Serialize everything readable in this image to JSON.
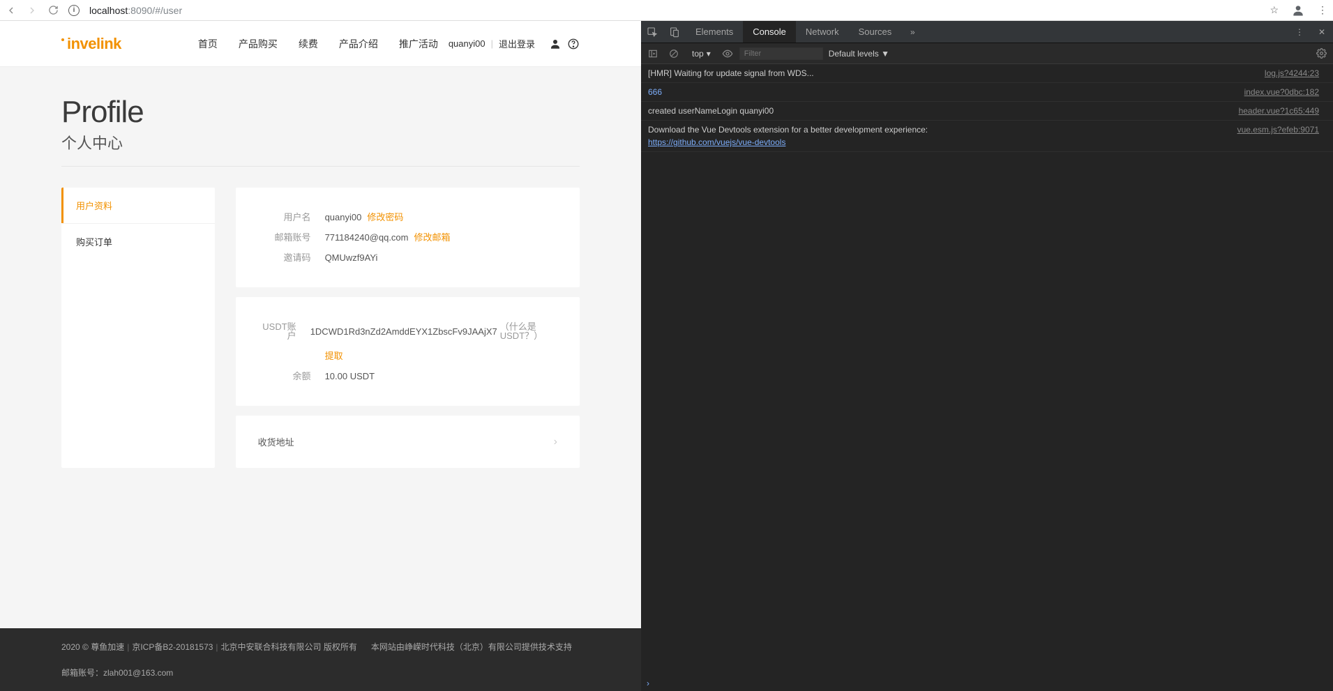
{
  "browser": {
    "url_host": "localhost",
    "url_port_path": ":8090/#/user"
  },
  "header": {
    "logo": "invelink",
    "nav": [
      "首页",
      "产品购买",
      "续费",
      "产品介绍",
      "推广活动"
    ],
    "username": "quanyi00",
    "logout": "退出登录"
  },
  "title": {
    "en": "Profile",
    "zh": "个人中心"
  },
  "sidebar": {
    "items": [
      {
        "label": "用户资料",
        "active": true
      },
      {
        "label": "购买订单",
        "active": false
      }
    ]
  },
  "profile": {
    "username_label": "用户名",
    "username_value": "quanyi00",
    "change_password": "修改密码",
    "email_label": "邮箱账号",
    "email_value": "771184240@qq.com",
    "change_email": "修改邮箱",
    "invite_label": "邀请码",
    "invite_value": "QMUwzf9AYi"
  },
  "wallet": {
    "usdt_label": "USDT账户",
    "usdt_value": "1DCWD1Rd3nZd2AmddEYX1ZbscFv9JAAjX7",
    "what_is": "（什么是USDT？）",
    "withdraw": "提取",
    "balance_label": "余额",
    "balance_value": "10.00 USDT"
  },
  "shipping": {
    "label": "收货地址"
  },
  "footer": {
    "copyright": "2020 © 尊鱼加速",
    "icp": "京ICP备B2-20181573",
    "company": "北京中安联合科技有限公司 版权所有",
    "support": "本网站由峥嵘时代科技（北京）有限公司提供技术支持",
    "email_label": "邮箱账号：",
    "email": "zlah001@163.com"
  },
  "devtools": {
    "tabs": [
      "Elements",
      "Console",
      "Network",
      "Sources"
    ],
    "active_tab": "Console",
    "context": "top",
    "filter_placeholder": "Filter",
    "levels": "Default levels ▼",
    "lines": [
      {
        "msg": "[HMR] Waiting for update signal from WDS...",
        "src": "log.js?4244:23",
        "cls": ""
      },
      {
        "msg": "666",
        "src": "index.vue?0dbc:182",
        "cls": "blue"
      },
      {
        "msg": "created userNameLogin quanyi00",
        "src": "header.vue?1c65:449",
        "cls": ""
      },
      {
        "msg": "Download the Vue Devtools extension for a better development experience:\n",
        "link": "https://github.com/vuejs/vue-devtools",
        "src": "vue.esm.js?efeb:9071",
        "cls": ""
      }
    ]
  }
}
